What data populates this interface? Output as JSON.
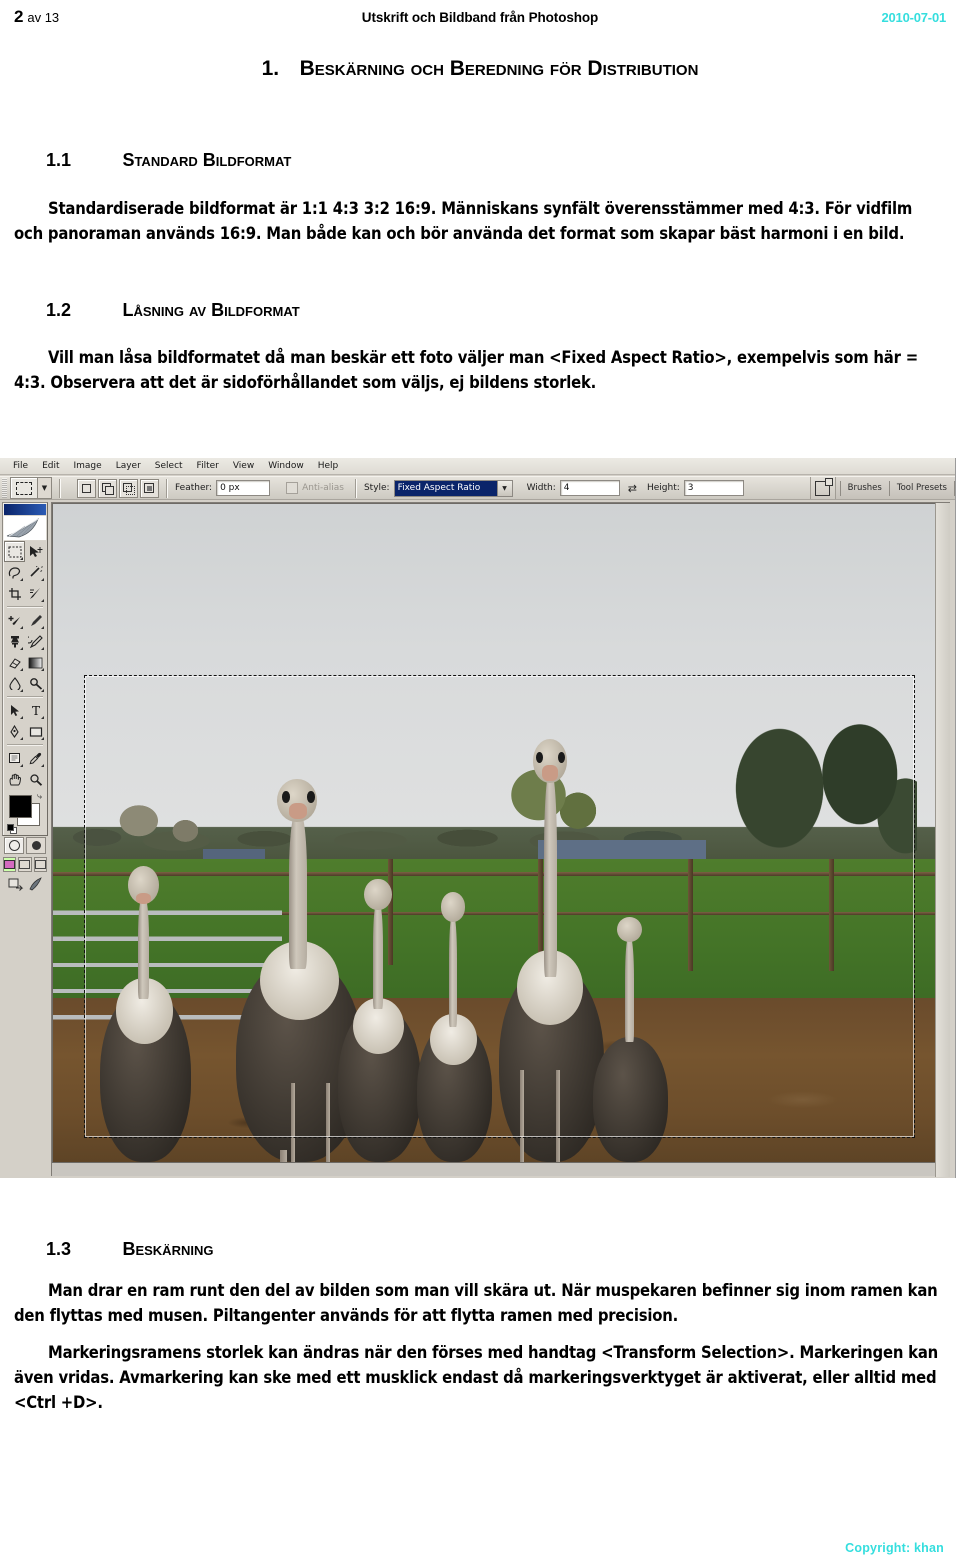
{
  "header": {
    "page_number": "2",
    "page_of": "av 13",
    "title": "Utskrift och Bildband från Photoshop",
    "date": "2010-07-01",
    "date_color": "#35dede"
  },
  "headings": {
    "h1_number": "1.",
    "h1_text": "Beskärning och Beredning för Distribution",
    "h2_1_number": "1.1",
    "h2_1_text": "Standard Bildformat",
    "h2_2_number": "1.2",
    "h2_2_text": "Låsning av Bildformat",
    "h2_3_number": "1.3",
    "h2_3_text": "Beskärning"
  },
  "paragraphs": {
    "p_1_1": "Standardiserade bildformat är 1:1  4:3  3:2  16:9. Människans synfält överensstämmer med 4:3. För vidfilm och panoraman används 16:9. Man både kan och bör använda det format som skapar bäst harmoni i en bild.",
    "p_1_2": "Vill man låsa bildformatet då man beskär ett foto väljer man <Fixed Aspect Ratio>, exempelvis som här = 4:3. Observera att det är sidoförhållandet som väljs, ej bildens storlek.",
    "p_1_3a": "Man drar en ram runt den del av bilden som man vill skära ut. När muspekaren befinner sig inom ramen kan den flyttas med musen. Piltangenter används för att flytta ramen med precision.",
    "p_1_3b": "Markeringsramens storlek kan ändras när den förses med handtag <Transform Selection>. Markeringen kan även vridas. Avmarkering kan ske med ett musklick endast då markeringsverktyget är aktiverat, eller alltid med <Ctrl +D>."
  },
  "photoshop": {
    "menu": [
      "File",
      "Edit",
      "Image",
      "Layer",
      "Select",
      "Filter",
      "View",
      "Window",
      "Help"
    ],
    "options_bar": {
      "feather_label": "Feather:",
      "feather_value": "0 px",
      "antialias_label": "Anti-alias",
      "style_label": "Style:",
      "style_value": "Fixed Aspect Ratio",
      "width_label": "Width:",
      "width_value": "4",
      "height_label": "Height:",
      "height_value": "3",
      "swap_glyph": "⇄"
    },
    "dock_tabs": [
      "Brushes",
      "Tool Presets"
    ],
    "toolbox": {
      "tools": [
        "rectangular-marquee-tool",
        "move-tool",
        "lasso-tool",
        "magic-wand-tool",
        "crop-tool",
        "slice-tool",
        "healing-brush-tool",
        "brush-tool",
        "clone-stamp-tool",
        "history-brush-tool",
        "eraser-tool",
        "gradient-tool",
        "blur-tool",
        "dodge-tool",
        "path-selection-tool",
        "type-tool",
        "pen-tool",
        "shape-tool",
        "notes-tool",
        "eyedropper-tool",
        "hand-tool",
        "zoom-tool"
      ],
      "foreground_color": "#000000",
      "background_color": "#ffffff"
    }
  },
  "photo": {
    "alt": "Flock av strutsar i hage med staket, rött hus och åkrar i bakgrunden"
  },
  "footer": {
    "copyright": "Copyright: khan",
    "color": "#35dede"
  }
}
